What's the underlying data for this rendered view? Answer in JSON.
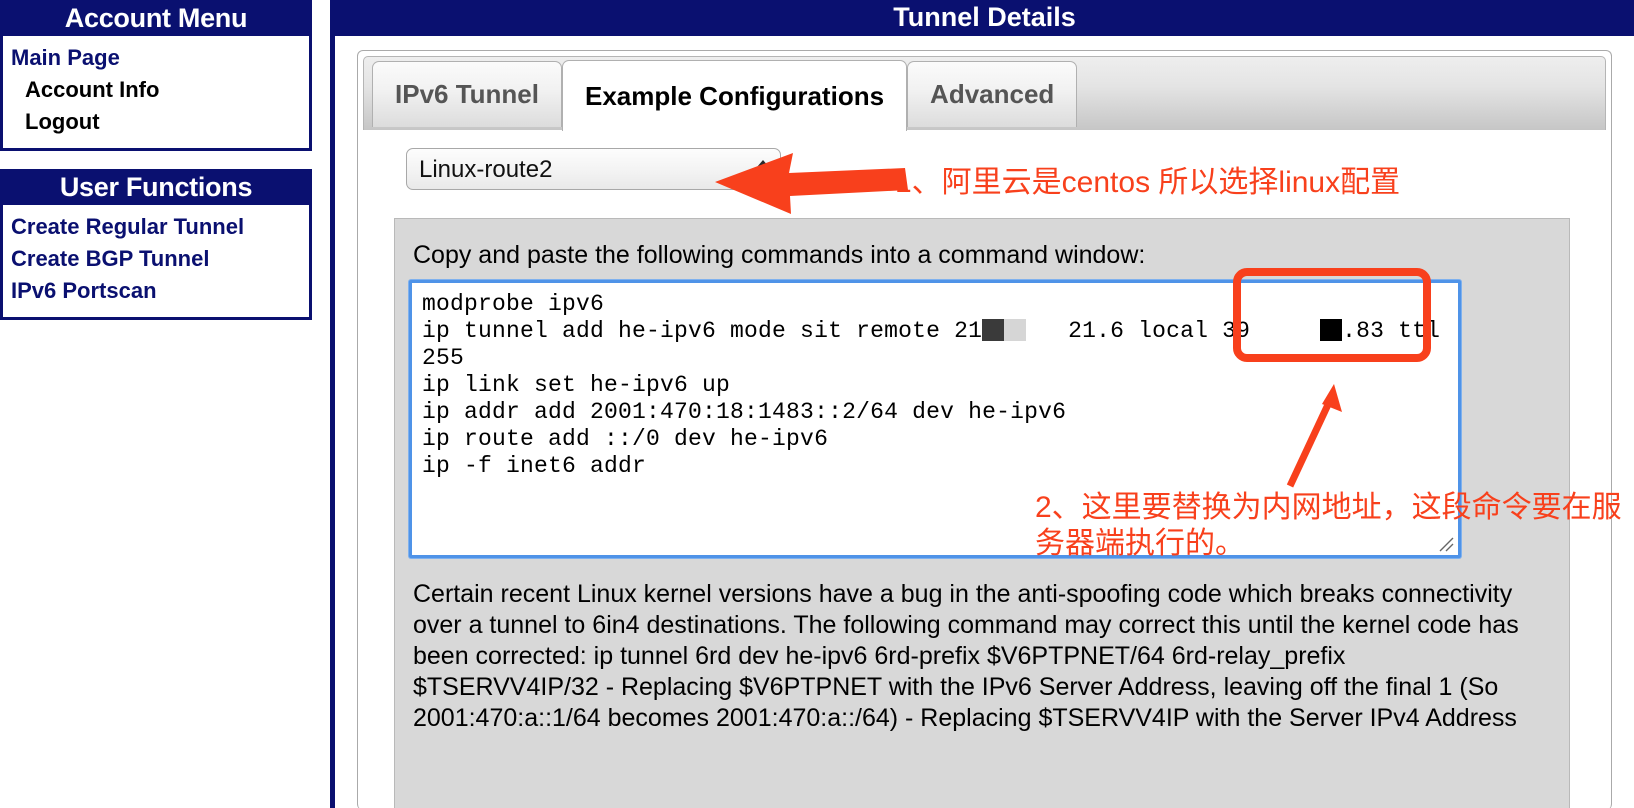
{
  "sidebar": {
    "account_menu": {
      "title": "Account Menu",
      "items": [
        {
          "label": "Main Page",
          "style": "plain"
        },
        {
          "label": "Account Info",
          "style": "sub"
        },
        {
          "label": "Logout",
          "style": "sub"
        }
      ]
    },
    "user_functions": {
      "title": "User Functions",
      "items": [
        {
          "label": "Create Regular Tunnel",
          "style": "plain"
        },
        {
          "label": "Create BGP Tunnel",
          "style": "plain"
        },
        {
          "label": "IPv6 Portscan",
          "style": "plain"
        }
      ]
    }
  },
  "main": {
    "title": "Tunnel Details",
    "tabs": [
      {
        "label": "IPv6 Tunnel",
        "active": false
      },
      {
        "label": "Example Configurations",
        "active": true
      },
      {
        "label": "Advanced",
        "active": false
      }
    ],
    "os_select": {
      "value": "Linux-route2",
      "options": [
        "Linux-route2"
      ]
    },
    "copy_label": "Copy and paste the following commands into a command window:",
    "code_lines": [
      "modprobe ipv6",
      "ip tunnel add he-ipv6 mode sit remote 21[redacted] [redacted] 21.6 local 39[redacted] [redacted].83 ttl 255",
      "ip link set he-ipv6 up",
      "ip addr add 2001:470:18:1483::2/64 dev he-ipv6",
      "ip route add ::/0 dev he-ipv6",
      "ip -f inet6 addr"
    ],
    "code_segments": {
      "line1": "modprobe ipv6",
      "line2_a": "ip tunnel add he-ipv6 mode sit remote 21",
      "line2_b": "   21.6 local ",
      "line2_c": "39",
      "line2_d": "     ",
      "line2_e": ".83 ttl",
      "line3": "255",
      "line4": "ip link set he-ipv6 up",
      "line5": "ip addr add 2001:470:18:1483::2/64 dev he-ipv6",
      "line6": "ip route add ::/0 dev he-ipv6",
      "line7": "ip -f inet6 addr"
    },
    "description": "Certain recent Linux kernel versions have a bug in the anti-spoofing code which breaks connectivity over a tunnel to 6in4 destinations. The following command may correct this until the kernel code has been corrected: ip tunnel 6rd dev he-ipv6 6rd-prefix $V6PTPNET/64 6rd-relay_prefix $TSERVV4IP/32 - Replacing $V6PTPNET with the IPv6 Server Address, leaving off the final 1 (So 2001:470:a::1/64 becomes 2001:470:a::/64) - Replacing $TSERVV4IP with the Server IPv4 Address"
  },
  "annotations": {
    "note1": "1、阿里云是centos 所以选择linux配置",
    "note2": "2、这里要替换为内网地址，这段命令要在服务器端执行的。"
  },
  "colors": {
    "navy": "#0a1070",
    "annotation_red": "#f8401c",
    "focus_blue": "#4f93e8",
    "panel_grey": "#d8d8d8"
  }
}
